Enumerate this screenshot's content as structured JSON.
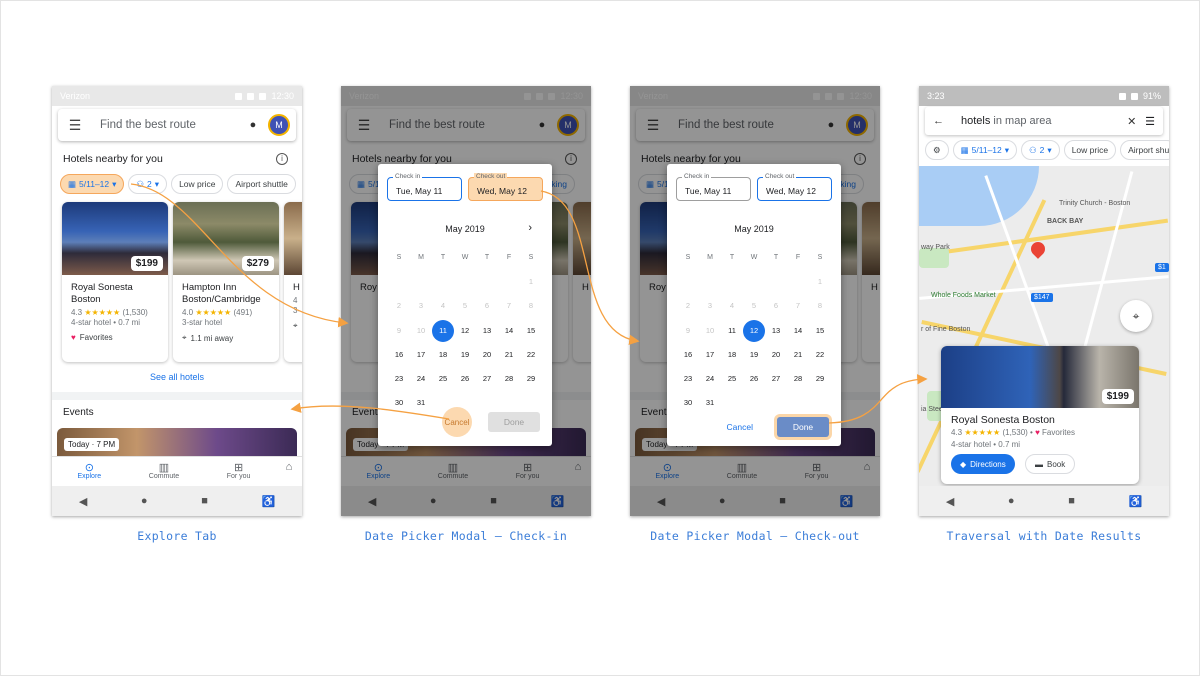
{
  "colors": {
    "accent": "#1a73e8",
    "highlight": "#f5a75c",
    "caption": "#3b7dd8"
  },
  "captions": [
    "Explore Tab",
    "Date Picker Modal – Check-in",
    "Date Picker Modal – Check-out",
    "Traversal with Date Results"
  ],
  "phone1": {
    "carrier": "Verizon",
    "time": "12:30",
    "search_placeholder": "Find the best route",
    "avatar": "M",
    "section_title": "Hotels nearby for you",
    "chips": [
      "5/11–12",
      "2",
      "Low price",
      "Airport shuttle"
    ],
    "hotels": [
      {
        "name": "Royal Sonesta Boston",
        "rating": "4.3",
        "stars": "★★★★★",
        "reviews": "(1,530)",
        "class": "4-star hotel • 0.7 mi",
        "extra": "Favorites",
        "extra_icon": "heart-icon",
        "price": "$199"
      },
      {
        "name": "Hampton Inn Boston/Cambridge",
        "rating": "4.0",
        "stars": "★★★★★",
        "reviews": "(491)",
        "class": "3-star hotel",
        "extra": "1.1 mi away",
        "extra_icon": "pin-icon",
        "price": "$279"
      },
      {
        "name": "H &",
        "rating": "4",
        "stars": "",
        "reviews": "",
        "class": "3-",
        "extra": "",
        "extra_icon": "pin-icon",
        "price": ""
      }
    ],
    "see_all": "See all hotels",
    "events_title": "Events",
    "event_badge": "Today · 7 PM",
    "tabs": [
      "Explore",
      "Commute",
      "For you"
    ]
  },
  "phone2": {
    "carrier": "Verizon",
    "time": "12:30",
    "search_placeholder": "Find the best route",
    "avatar": "M",
    "section_title": "Hotels nearby for you",
    "chips": [
      "5/11–12",
      "2",
      "Low price",
      "Parking"
    ],
    "check_in_label": "Check in",
    "check_in_value": "Tue, May 11",
    "check_out_label": "Check out",
    "check_out_value": "Wed, May 12",
    "month": "May 2019",
    "selected_day": "11",
    "cancel": "Cancel",
    "done": "Done",
    "bg_hotels": [
      "Roy Bos",
      "H &"
    ],
    "events_title": "Events",
    "event_badge": "Today · 7 PM",
    "tabs": [
      "Explore",
      "Commute",
      "For you"
    ]
  },
  "phone3": {
    "carrier": "Verizon",
    "time": "12:30",
    "search_placeholder": "Find the best route",
    "avatar": "M",
    "section_title": "Hotels nearby for you",
    "chips": [
      "5/11–12",
      "2",
      "Low price",
      "Parking"
    ],
    "check_in_label": "Check in",
    "check_in_value": "Tue, May 11",
    "check_out_label": "Check out",
    "check_out_value": "Wed, May 12",
    "month": "May 2019",
    "selected_day": "12",
    "cancel": "Cancel",
    "done": "Done",
    "bg_hotels": [
      "Roy Bos",
      "H &"
    ],
    "events_title": "Events",
    "event_badge": "Today · 7 PM",
    "tabs": [
      "Explore",
      "Commute",
      "For you"
    ]
  },
  "calendar": {
    "dow": [
      "S",
      "M",
      "T",
      "W",
      "T",
      "F",
      "S"
    ],
    "weeks": [
      [
        "",
        "",
        "",
        "",
        "",
        "",
        "1"
      ],
      [
        "2",
        "3",
        "4",
        "5",
        "6",
        "7",
        "8"
      ],
      [
        "9",
        "10",
        "11",
        "12",
        "13",
        "14",
        "15"
      ],
      [
        "16",
        "17",
        "18",
        "19",
        "20",
        "21",
        "22"
      ],
      [
        "23",
        "24",
        "25",
        "26",
        "27",
        "28",
        "29"
      ],
      [
        "30",
        "31",
        "",
        "",
        "",
        "",
        ""
      ]
    ]
  },
  "phone4": {
    "time": "3:23",
    "battery": "91%",
    "query_bold": "hotels",
    "query_rest": " in map area",
    "chips": [
      "5/11–12",
      "2",
      "Low price",
      "Airport shu"
    ],
    "map_labels": [
      "Trinity Church - Boston",
      "BACK BAY",
      "way Park",
      "Whole Foods Market",
      "r of Fine Boston",
      "ia Stee iagre"
    ],
    "map_prices": [
      "$147",
      "$1"
    ],
    "hotel": {
      "name": "Royal Sonesta Boston",
      "rating": "4.3",
      "stars": "★★★★★",
      "reviews": "(1,530)",
      "favorites": "Favorites",
      "class": "4-star hotel • 0.7 mi",
      "price": "$199"
    },
    "buttons": [
      "Directions",
      "Book"
    ]
  }
}
